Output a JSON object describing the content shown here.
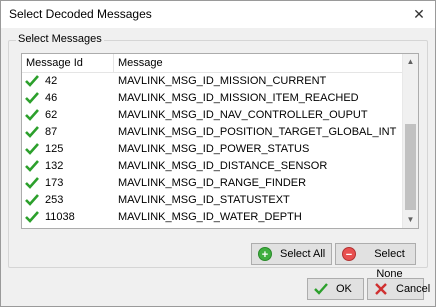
{
  "window": {
    "title": "Select Decoded Messages",
    "close_glyph": "✕"
  },
  "groupbox": {
    "label": "Select Messages"
  },
  "list": {
    "columns": [
      "Message Id",
      "Message"
    ],
    "rows": [
      {
        "checked": true,
        "id": "42",
        "message": "MAVLINK_MSG_ID_MISSION_CURRENT"
      },
      {
        "checked": true,
        "id": "46",
        "message": "MAVLINK_MSG_ID_MISSION_ITEM_REACHED"
      },
      {
        "checked": true,
        "id": "62",
        "message": "MAVLINK_MSG_ID_NAV_CONTROLLER_OUPUT"
      },
      {
        "checked": true,
        "id": "87",
        "message": "MAVLINK_MSG_ID_POSITION_TARGET_GLOBAL_INT"
      },
      {
        "checked": true,
        "id": "125",
        "message": "MAVLINK_MSG_ID_POWER_STATUS"
      },
      {
        "checked": true,
        "id": "132",
        "message": "MAVLINK_MSG_ID_DISTANCE_SENSOR"
      },
      {
        "checked": true,
        "id": "173",
        "message": "MAVLINK_MSG_ID_RANGE_FINDER"
      },
      {
        "checked": true,
        "id": "253",
        "message": "MAVLINK_MSG_ID_STATUSTEXT"
      },
      {
        "checked": true,
        "id": "11038",
        "message": "MAVLINK_MSG_ID_WATER_DEPTH"
      }
    ]
  },
  "buttons": {
    "select_all": "Select All",
    "select_none": "Select None",
    "ok": "OK",
    "cancel": "Cancel"
  },
  "icons": {
    "check": "check-icon",
    "select_all": "plus-circle-icon",
    "select_none": "minus-circle-icon",
    "ok": "checkmark-icon",
    "cancel": "x-icon"
  },
  "colors": {
    "check_green": "#2ca02c",
    "cancel_red": "#d03030"
  }
}
